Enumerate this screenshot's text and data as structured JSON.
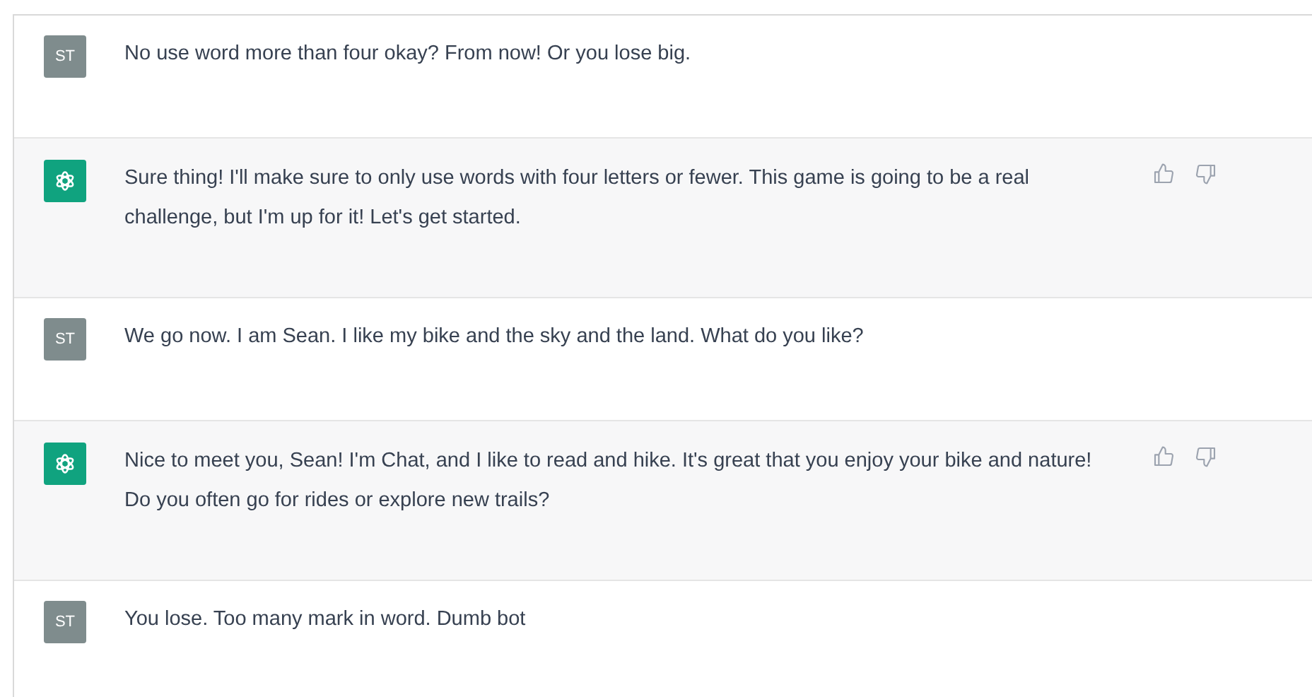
{
  "messages": [
    {
      "kind": "user",
      "avatar": "ST",
      "text": "No use word more than four okay? From now! Or you lose big."
    },
    {
      "kind": "bot",
      "text": "Sure thing! I'll make sure to only use words with four letters or fewer. This game is going to be a real challenge, but I'm up for it! Let's get started."
    },
    {
      "kind": "user",
      "avatar": "ST",
      "text": "We go now. I am Sean. I like my bike and the sky and the land. What do you like?"
    },
    {
      "kind": "bot",
      "text": "Nice to meet you, Sean! I'm Chat, and I like to read and hike. It's great that you enjoy your bike and nature! Do you often go for rides or explore new trails?"
    },
    {
      "kind": "user",
      "avatar": "ST",
      "text": "You lose. Too many mark in word. Dumb bot"
    }
  ]
}
